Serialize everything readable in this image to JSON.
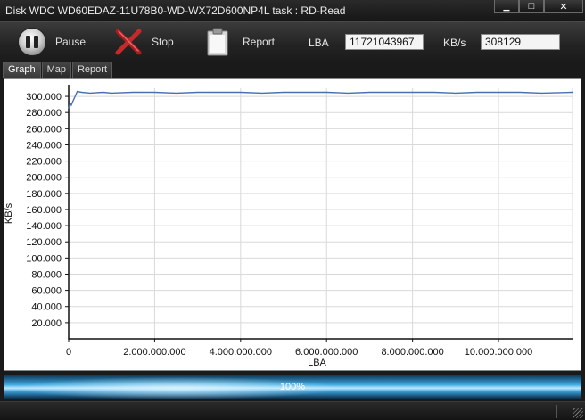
{
  "window": {
    "title": "Disk WDC WD60EDAZ-11U78B0-WD-WX72D600NP4L   task : RD-Read",
    "minimize_glyph": "▁",
    "maximize_glyph": "□",
    "close_glyph": "✕"
  },
  "toolbar": {
    "pause_label": "Pause",
    "stop_label": "Stop",
    "report_label": "Report",
    "lba_label": "LBA",
    "lba_value": "11721043967",
    "kbs_label": "KB/s",
    "kbs_value": "308129"
  },
  "tabs": [
    {
      "label": "Graph",
      "active": true
    },
    {
      "label": "Map",
      "active": false
    },
    {
      "label": "Report",
      "active": false
    }
  ],
  "chart_data": {
    "type": "line",
    "xlabel": "LBA",
    "ylabel": "KB/s",
    "xlim": [
      0,
      11721043967
    ],
    "ylim": [
      0,
      310000
    ],
    "x_ticks": [
      0,
      2000000000,
      4000000000,
      6000000000,
      8000000000,
      10000000000
    ],
    "x_tick_labels": [
      "0",
      "2.000.000.000",
      "4.000.000.000",
      "6.000.000.000",
      "8.000.000.000",
      "10.000.000.000"
    ],
    "y_ticks": [
      20000,
      40000,
      60000,
      80000,
      100000,
      120000,
      140000,
      160000,
      180000,
      200000,
      220000,
      240000,
      260000,
      280000,
      300000
    ],
    "y_tick_labels": [
      "20.000",
      "40.000",
      "60.000",
      "80.000",
      "100.000",
      "120.000",
      "140.000",
      "160.000",
      "180.000",
      "200.000",
      "220.000",
      "240.000",
      "260.000",
      "280.000",
      "300.000"
    ],
    "grid": true,
    "series": [
      {
        "color": "#4a6fb0",
        "x": [
          0,
          30000000,
          60000000,
          100000000,
          150000000,
          200000000,
          300000000,
          500000000,
          800000000,
          1000000000,
          1500000000,
          2000000000,
          2500000000,
          3000000000,
          3500000000,
          4000000000,
          4500000000,
          5000000000,
          5500000000,
          6000000000,
          6500000000,
          7000000000,
          7500000000,
          8000000000,
          8500000000,
          9000000000,
          9500000000,
          10000000000,
          10500000000,
          11000000000,
          11721043967
        ],
        "values": [
          285000,
          292000,
          289000,
          294000,
          300000,
          306000,
          305000,
          304000,
          305000,
          304000,
          305000,
          305000,
          304000,
          305000,
          305000,
          305000,
          304000,
          305000,
          305000,
          305000,
          304000,
          305000,
          305000,
          305000,
          305000,
          304000,
          305000,
          305000,
          305000,
          304000,
          305000
        ]
      }
    ]
  },
  "progress": {
    "value": 1.0,
    "label": "100%"
  }
}
